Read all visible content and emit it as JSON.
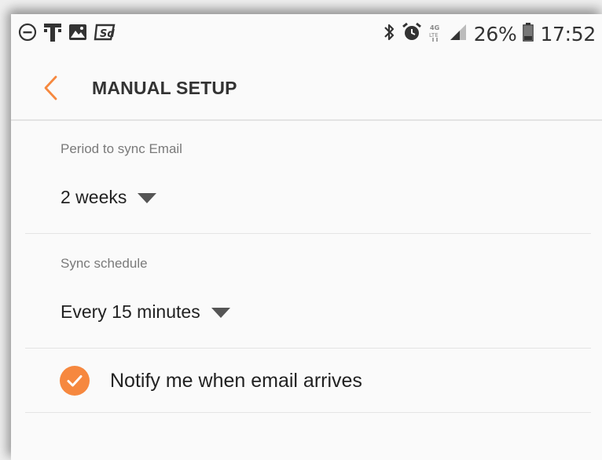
{
  "status_bar": {
    "left_icons": [
      "do-not-disturb-icon",
      "t-mobile-icon",
      "gallery-icon",
      "signal-app-icon"
    ],
    "right_icons": [
      "bluetooth-icon",
      "alarm-icon",
      "lte-icon",
      "signal-icon"
    ],
    "battery": "26%",
    "time": "17:52"
  },
  "appbar": {
    "back_icon": "chevron-left-icon",
    "title": "MANUAL SETUP"
  },
  "sync_period": {
    "label": "Period to sync Email",
    "value": "2 weeks"
  },
  "sync_schedule": {
    "label": "Sync schedule",
    "value": "Every 15 minutes"
  },
  "notify": {
    "label": "Notify me when email arrives",
    "checked": true
  },
  "colors": {
    "accent": "#f6883f",
    "background": "#fafafa",
    "text": "#222222",
    "secondary_text": "#7a7a7a"
  }
}
